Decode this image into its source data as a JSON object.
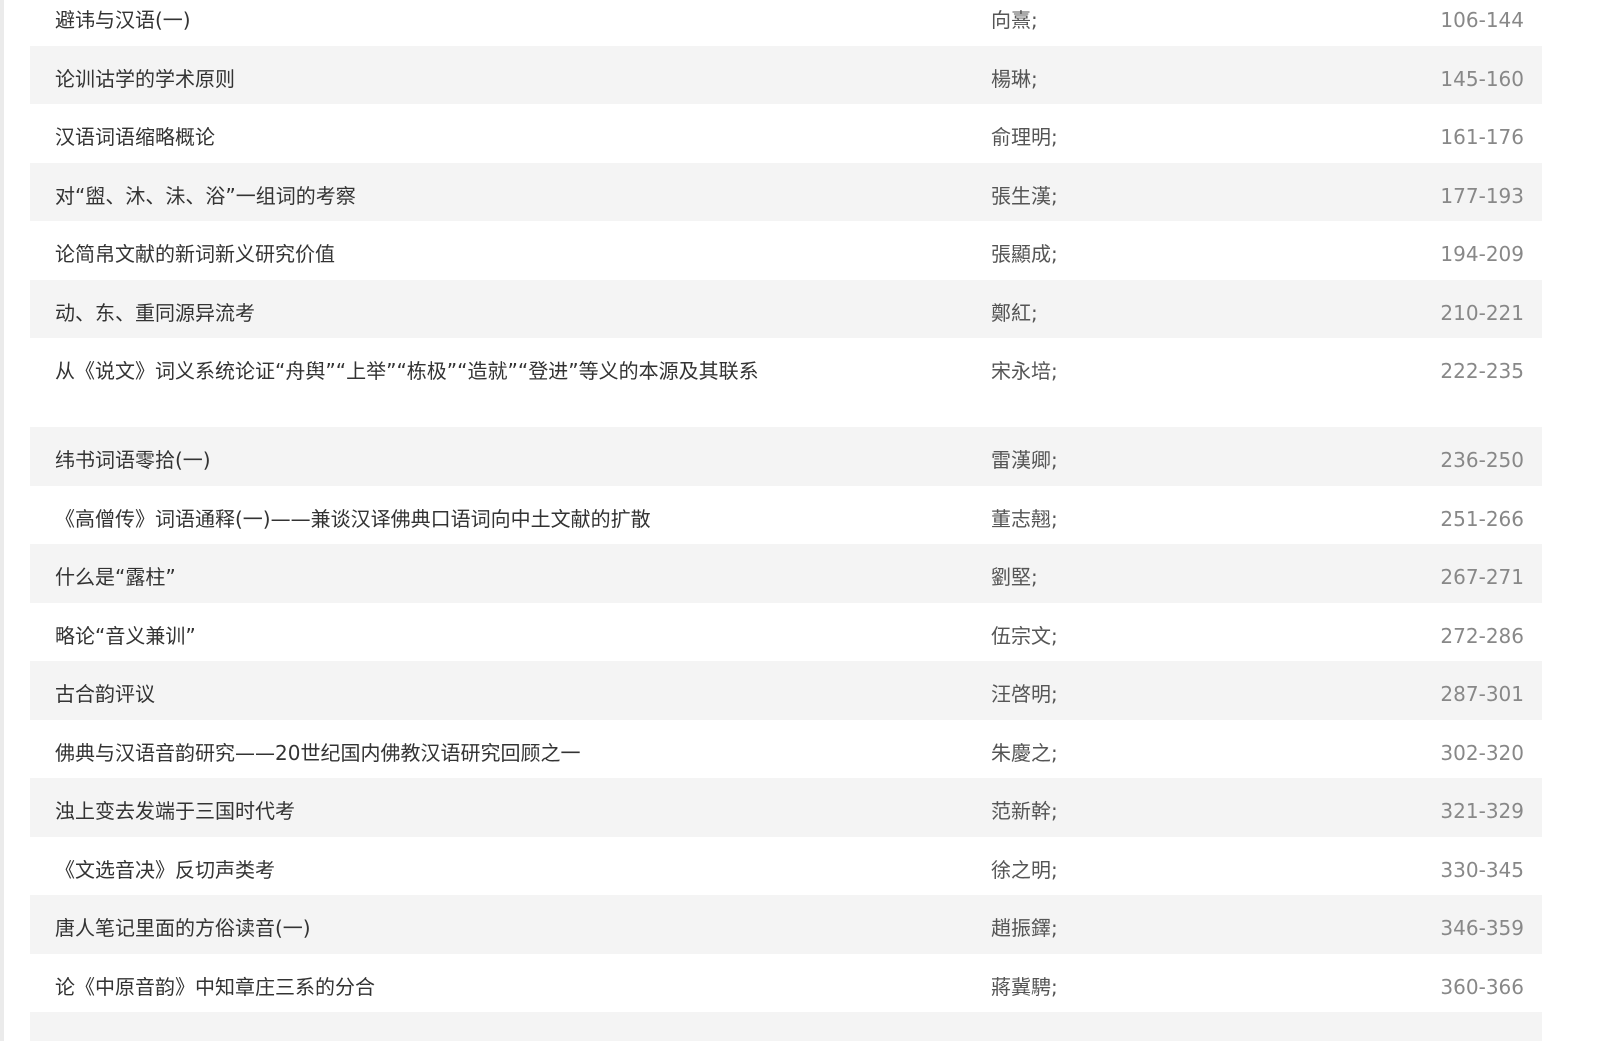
{
  "articles": [
    {
      "title": "避讳与汉语(一)",
      "author": "向熹;",
      "pages": "106-144"
    },
    {
      "title": "论训诂学的学术原则",
      "author": "楊琳;",
      "pages": "145-160"
    },
    {
      "title": "汉语词语缩略概论",
      "author": "俞理明;",
      "pages": "161-176"
    },
    {
      "title": "对“盥、沐、沬、浴”一组词的考察",
      "author": "張生漢;",
      "pages": "177-193"
    },
    {
      "title": "论简帛文献的新词新义研究价值",
      "author": "張顯成;",
      "pages": "194-209"
    },
    {
      "title": "动、东、重同源异流考",
      "author": "鄭紅;",
      "pages": "210-221"
    },
    {
      "title": "从《说文》词义系统论证“舟舆”“上举”“栋极”“造就”“登进”等义的本源及其联系",
      "author": "宋永培;",
      "pages": "222-235"
    },
    {
      "title": "纬书词语零拾(一)",
      "author": "雷漢卿;",
      "pages": "236-250"
    },
    {
      "title": "《高僧传》词语通释(一)——兼谈汉译佛典口语词向中土文献的扩散",
      "author": "董志翹;",
      "pages": "251-266"
    },
    {
      "title": "什么是“露柱”",
      "author": "劉堅;",
      "pages": "267-271"
    },
    {
      "title": "略论“音义兼训”",
      "author": "伍宗文;",
      "pages": "272-286"
    },
    {
      "title": "古合韵评议",
      "author": "汪啓明;",
      "pages": "287-301"
    },
    {
      "title": "佛典与汉语音韵研究——20世纪国内佛教汉语研究回顾之一",
      "author": "朱慶之;",
      "pages": "302-320"
    },
    {
      "title": "浊上变去发端于三国时代考",
      "author": "范新幹;",
      "pages": "321-329"
    },
    {
      "title": "《文选音决》反切声类考",
      "author": "徐之明;",
      "pages": "330-345"
    },
    {
      "title": "唐人笔记里面的方俗读音(一)",
      "author": "趙振鐸;",
      "pages": "346-359"
    },
    {
      "title": "论《中原音韵》中知章庄三系的分合",
      "author": "蔣冀騁;",
      "pages": "360-366"
    },
    {
      "title": "",
      "author": "",
      "pages": ""
    }
  ]
}
